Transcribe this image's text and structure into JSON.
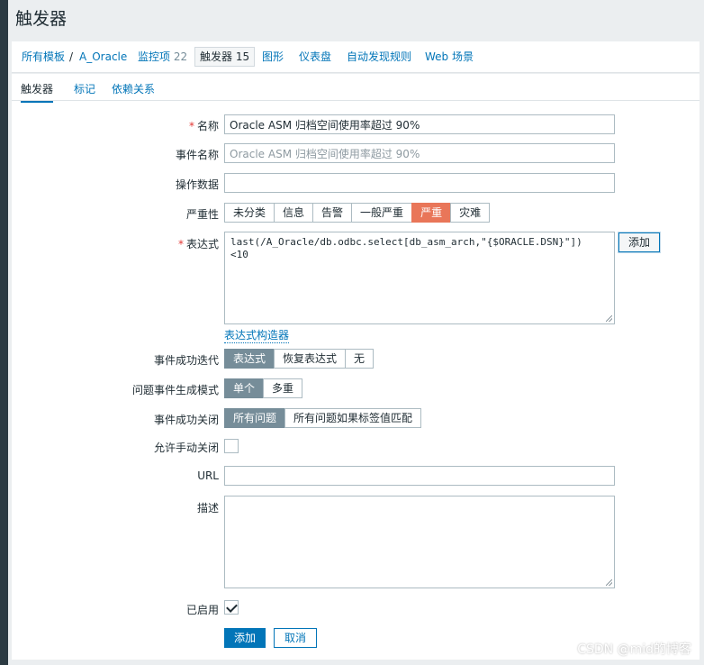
{
  "page": {
    "title": "触发器"
  },
  "nav": {
    "all_templates": "所有模板",
    "separator": "/",
    "host": "A_Oracle",
    "items_label": "监控项",
    "items_count": "22",
    "triggers_label": "触发器",
    "triggers_count": "15",
    "graphs": "图形",
    "dashboards": "仪表盘",
    "discovery": "自动发现规则",
    "web": "Web 场景"
  },
  "tabs": [
    "触发器",
    "标记",
    "依赖关系"
  ],
  "form": {
    "name": {
      "label": "名称",
      "required": "*",
      "value": "Oracle ASM 归档空间使用率超过 90%"
    },
    "event_name": {
      "label": "事件名称",
      "placeholder": "Oracle ASM 归档空间使用率超过 90%"
    },
    "opdata": {
      "label": "操作数据",
      "value": ""
    },
    "severity": {
      "label": "严重性",
      "options": [
        "未分类",
        "信息",
        "告警",
        "一般严重",
        "严重",
        "灾难"
      ],
      "selected": "严重"
    },
    "expression": {
      "label": "表达式",
      "required": "*",
      "line1": "last(/A_Oracle/db.odbc.select[db_asm_arch,\"{$ORACLE.DSN}\"])",
      "line2": "<10",
      "add_button": "添加",
      "constructor_link": "表达式构造器"
    },
    "ok_event_generation": {
      "label": "事件成功迭代",
      "options": [
        "表达式",
        "恢复表达式",
        "无"
      ],
      "selected": "表达式"
    },
    "problem_event_generation": {
      "label": "问题事件生成模式",
      "options": [
        "单个",
        "多重"
      ],
      "selected": "单个"
    },
    "ok_event_closes": {
      "label": "事件成功关闭",
      "options": [
        "所有问题",
        "所有问题如果标签值匹配"
      ],
      "selected": "所有问题"
    },
    "manual_close": {
      "label": "允许手动关闭",
      "checked": false
    },
    "url": {
      "label": "URL",
      "value": ""
    },
    "description": {
      "label": "描述",
      "value": ""
    },
    "enabled": {
      "label": "已启用",
      "checked": true
    },
    "buttons": {
      "add": "添加",
      "cancel": "取消"
    }
  },
  "watermark": "CSDN @mid的博客",
  "colors": {
    "accent": "#0275b8",
    "severity_high": "#e97659",
    "selected_segment": "#768d99"
  }
}
